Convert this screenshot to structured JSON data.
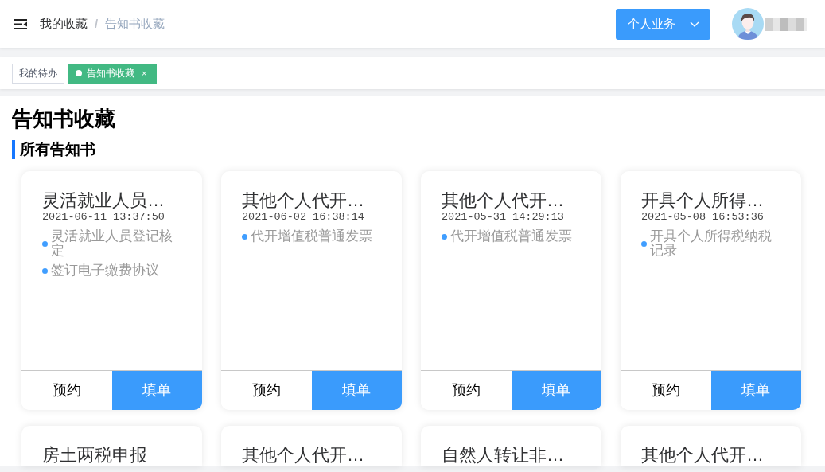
{
  "header": {
    "breadcrumb": [
      {
        "label": "我的收藏",
        "current": false
      },
      {
        "label": "告知书收藏",
        "current": true
      }
    ],
    "breadcrumb_separator": "/",
    "menu_button": {
      "label": "个人业务"
    }
  },
  "tags": [
    {
      "label": "我的待办",
      "selected": false
    },
    {
      "label": "告知书收藏",
      "selected": true,
      "close_mark": "×"
    }
  ],
  "page_title": "告知书收藏",
  "section_title": "所有告知书",
  "cards": [
    {
      "title": "灵活就业人员…",
      "time": "2021-06-11 13:37:50",
      "items": [
        "灵活就业人员登记核定",
        "签订电子缴费协议"
      ],
      "actions": [
        {
          "label": "预约",
          "kind": "secondary"
        },
        {
          "label": "填单",
          "kind": "primary"
        }
      ]
    },
    {
      "title": "其他个人代开…",
      "time": "2021-06-02 16:38:14",
      "items": [
        "代开增值税普通发票"
      ],
      "actions": [
        {
          "label": "预约",
          "kind": "secondary"
        },
        {
          "label": "填单",
          "kind": "primary"
        }
      ]
    },
    {
      "title": "其他个人代开…",
      "time": "2021-05-31 14:29:13",
      "items": [
        "代开增值税普通发票"
      ],
      "actions": [
        {
          "label": "预约",
          "kind": "secondary"
        },
        {
          "label": "填单",
          "kind": "primary"
        }
      ]
    },
    {
      "title": "开具个人所得…",
      "time": "2021-05-08 16:53:36",
      "items": [
        "开具个人所得税纳税记录"
      ],
      "actions": [
        {
          "label": "预约",
          "kind": "secondary"
        },
        {
          "label": "填单",
          "kind": "primary"
        }
      ]
    },
    {
      "title": "房土两税申报"
    },
    {
      "title": "其他个人代开…"
    },
    {
      "title": "自然人转让非…"
    },
    {
      "title": "其他个人代开…"
    }
  ]
}
